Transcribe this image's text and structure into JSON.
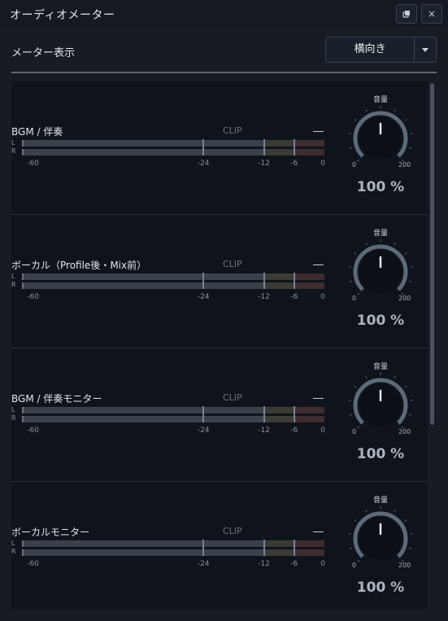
{
  "window": {
    "title": "オーディオメーター",
    "popout_icon": "popout-icon",
    "close_icon": "close-icon",
    "close_glyph": "×"
  },
  "controls": {
    "meter_display_label": "メーター表示",
    "orientation_value": "横向き"
  },
  "meter_scale": {
    "lr_top": "L",
    "lr_bottom": "R",
    "labels": [
      "-60",
      "-24",
      "-12",
      "-6",
      "0"
    ]
  },
  "channels": [
    {
      "name": "BGM / 伴奏",
      "clip": "CLIP",
      "volume_title": "音量",
      "volume": "100 %",
      "volume_min": "0",
      "volume_max": "200",
      "volume_level": 0.5
    },
    {
      "name": "ボーカル（Profile後・Mix前）",
      "clip": "CLIP",
      "volume_title": "音量",
      "volume": "100 %",
      "volume_min": "0",
      "volume_max": "200",
      "volume_level": 0.5
    },
    {
      "name": "BGM / 伴奏モニター",
      "clip": "CLIP",
      "volume_title": "音量",
      "volume": "100 %",
      "volume_min": "0",
      "volume_max": "200",
      "volume_level": 0.5
    },
    {
      "name": "ボーカルモニター",
      "clip": "CLIP",
      "volume_title": "音量",
      "volume": "100 %",
      "volume_min": "0",
      "volume_max": "200",
      "volume_level": 0.5
    }
  ],
  "colors": {
    "background": "#161b24",
    "panel": "#0f141c",
    "meter_green_zone": "#3b414b",
    "meter_yellow_zone": "#3b3b35",
    "meter_red_zone": "#3f2c30",
    "knob_arc": "#5d6b78"
  }
}
